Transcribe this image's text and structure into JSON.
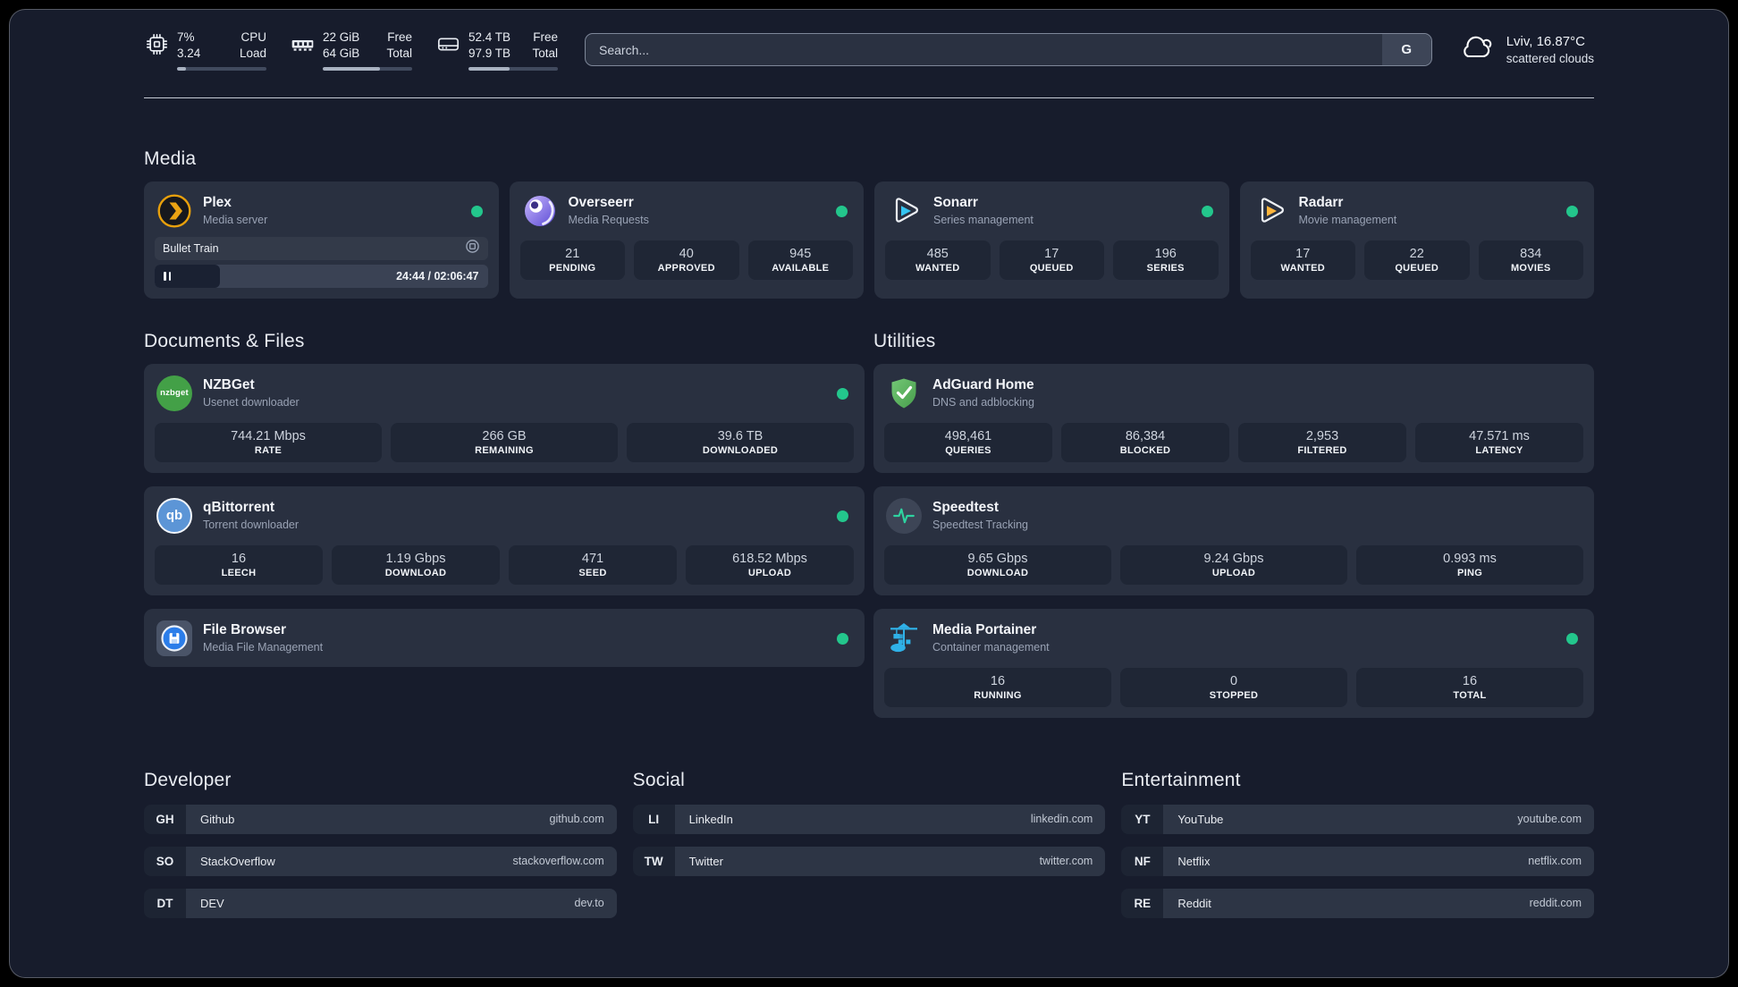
{
  "app": {
    "status_green": "#23c68c"
  },
  "header": {
    "cpu": {
      "value1": "7%",
      "value2": "3.24",
      "label1": "CPU",
      "label2": "Load",
      "progress": 10
    },
    "memory": {
      "value1": "22 GiB",
      "value2": "64 GiB",
      "label1": "Free",
      "label2": "Total",
      "progress": 64
    },
    "storage": {
      "value1": "52.4 TB",
      "value2": "97.9 TB",
      "label1": "Free",
      "label2": "Total",
      "progress": 46
    },
    "search": {
      "placeholder": "Search...",
      "engine_button": "G"
    },
    "weather": {
      "location": "Lviv, 16.87°C",
      "condition": "scattered clouds"
    }
  },
  "media": {
    "title": "Media",
    "plex": {
      "name": "Plex",
      "subtitle": "Media server",
      "now_playing": {
        "title": "Bullet Train",
        "time": "24:44 / 02:06:47",
        "progress": 19.5
      }
    },
    "overseerr": {
      "name": "Overseerr",
      "subtitle": "Media Requests",
      "stats": [
        {
          "value": "21",
          "label": "PENDING"
        },
        {
          "value": "40",
          "label": "APPROVED"
        },
        {
          "value": "945",
          "label": "AVAILABLE"
        }
      ]
    },
    "sonarr": {
      "name": "Sonarr",
      "subtitle": "Series management",
      "stats": [
        {
          "value": "485",
          "label": "WANTED"
        },
        {
          "value": "17",
          "label": "QUEUED"
        },
        {
          "value": "196",
          "label": "SERIES"
        }
      ]
    },
    "radarr": {
      "name": "Radarr",
      "subtitle": "Movie management",
      "stats": [
        {
          "value": "17",
          "label": "WANTED"
        },
        {
          "value": "22",
          "label": "QUEUED"
        },
        {
          "value": "834",
          "label": "MOVIES"
        }
      ]
    }
  },
  "documents": {
    "title": "Documents & Files",
    "nzbget": {
      "name": "NZBGet",
      "subtitle": "Usenet downloader",
      "icon_text": "nzbget",
      "stats": [
        {
          "value": "744.21 Mbps",
          "label": "RATE"
        },
        {
          "value": "266 GB",
          "label": "REMAINING"
        },
        {
          "value": "39.6 TB",
          "label": "DOWNLOADED"
        }
      ]
    },
    "qbittorrent": {
      "name": "qBittorrent",
      "subtitle": "Torrent downloader",
      "icon_text": "qb",
      "stats": [
        {
          "value": "16",
          "label": "LEECH"
        },
        {
          "value": "1.19 Gbps",
          "label": "DOWNLOAD"
        },
        {
          "value": "471",
          "label": "SEED"
        },
        {
          "value": "618.52 Mbps",
          "label": "UPLOAD"
        }
      ]
    },
    "filebrowser": {
      "name": "File Browser",
      "subtitle": "Media File Management"
    }
  },
  "utilities": {
    "title": "Utilities",
    "adguard": {
      "name": "AdGuard Home",
      "subtitle": "DNS and adblocking",
      "stats": [
        {
          "value": "498,461",
          "label": "QUERIES"
        },
        {
          "value": "86,384",
          "label": "BLOCKED"
        },
        {
          "value": "2,953",
          "label": "FILTERED"
        },
        {
          "value": "47.571 ms",
          "label": "LATENCY"
        }
      ]
    },
    "speedtest": {
      "name": "Speedtest",
      "subtitle": "Speedtest Tracking",
      "stats": [
        {
          "value": "9.65 Gbps",
          "label": "DOWNLOAD"
        },
        {
          "value": "9.24 Gbps",
          "label": "UPLOAD"
        },
        {
          "value": "0.993 ms",
          "label": "PING"
        }
      ]
    },
    "portainer": {
      "name": "Media Portainer",
      "subtitle": "Container management",
      "stats": [
        {
          "value": "16",
          "label": "RUNNING"
        },
        {
          "value": "0",
          "label": "STOPPED"
        },
        {
          "value": "16",
          "label": "TOTAL"
        }
      ]
    }
  },
  "links": {
    "developer": {
      "title": "Developer",
      "items": [
        {
          "badge": "GH",
          "name": "Github",
          "url": "github.com"
        },
        {
          "badge": "SO",
          "name": "StackOverflow",
          "url": "stackoverflow.com"
        },
        {
          "badge": "DT",
          "name": "DEV",
          "url": "dev.to"
        }
      ]
    },
    "social": {
      "title": "Social",
      "items": [
        {
          "badge": "LI",
          "name": "LinkedIn",
          "url": "linkedin.com"
        },
        {
          "badge": "TW",
          "name": "Twitter",
          "url": "twitter.com"
        }
      ]
    },
    "entertainment": {
      "title": "Entertainment",
      "items": [
        {
          "badge": "YT",
          "name": "YouTube",
          "url": "youtube.com"
        },
        {
          "badge": "NF",
          "name": "Netflix",
          "url": "netflix.com"
        },
        {
          "badge": "RE",
          "name": "Reddit",
          "url": "reddit.com"
        }
      ]
    }
  }
}
